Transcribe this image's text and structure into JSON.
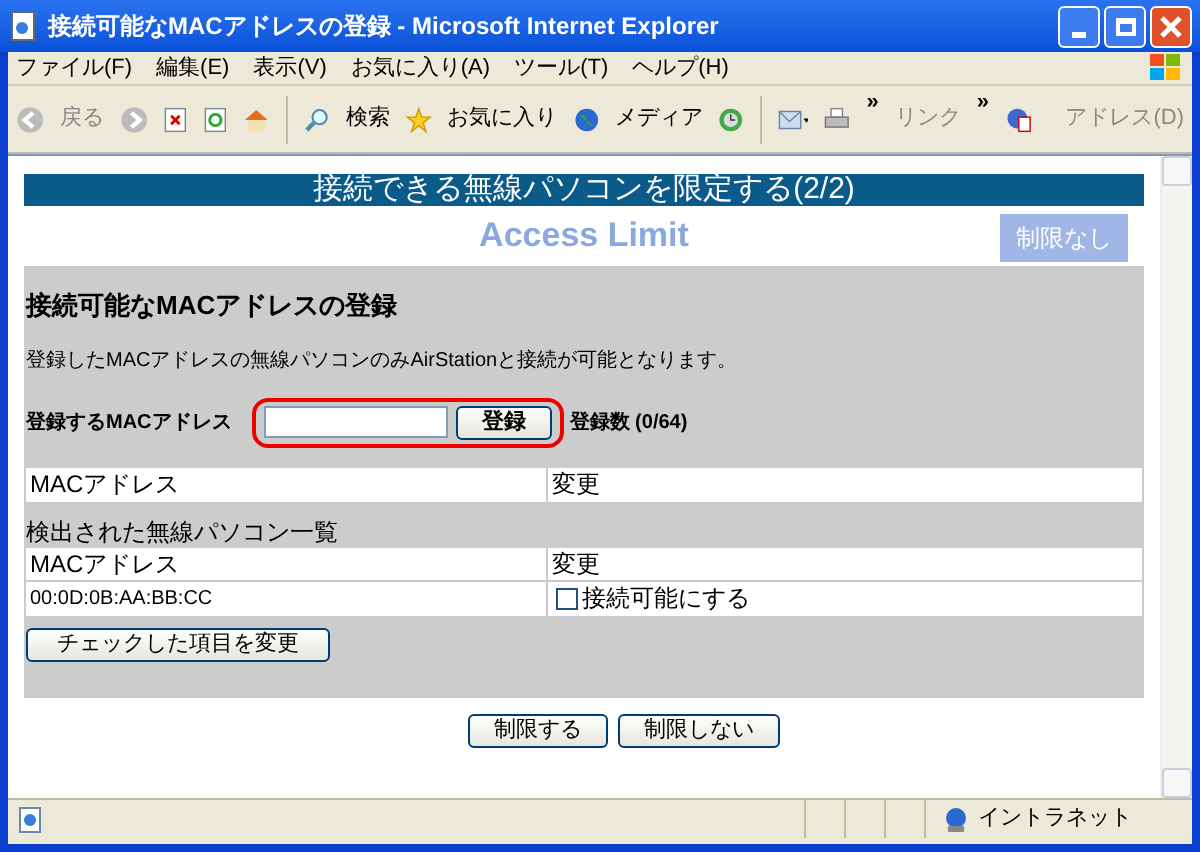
{
  "window": {
    "title": "接続可能なMACアドレスの登録 - Microsoft Internet Explorer"
  },
  "menu": [
    "ファイル(F)",
    "編集(E)",
    "表示(V)",
    "お気に入り(A)",
    "ツール(T)",
    "ヘルプ(H)"
  ],
  "toolbar": {
    "back": "戻る",
    "search": "検索",
    "favorites": "お気に入り",
    "media": "メディア",
    "more_1": "»",
    "links": "リンク",
    "more_2": "»",
    "address": "アドレス(D)"
  },
  "page": {
    "banner": "接続できる無線パソコンを限定する(2/2)",
    "logo": "Access Limit",
    "status_badge": "制限なし",
    "section_title": "接続可能なMACアドレスの登録",
    "description": "登録したMACアドレスの無線パソコンのみAirStationと接続が可能となります。",
    "register": {
      "label": "登録するMACアドレス",
      "button": "登録",
      "count": "登録数 (0/64)"
    },
    "registered_table": {
      "columns": [
        "MACアドレス",
        "変更"
      ]
    },
    "detected_title": "検出された無線パソコン一覧",
    "detected_table": {
      "columns": [
        "MACアドレス",
        "変更"
      ],
      "rows": [
        {
          "mac": "00:0D:0B:AA:BB:CC",
          "option": "接続可能にする",
          "checked": false
        }
      ]
    },
    "apply_button": "チェックした項目を変更",
    "buttons": [
      "制限する",
      "制限しない"
    ]
  },
  "status_bar": {
    "zone": "イントラネット"
  }
}
